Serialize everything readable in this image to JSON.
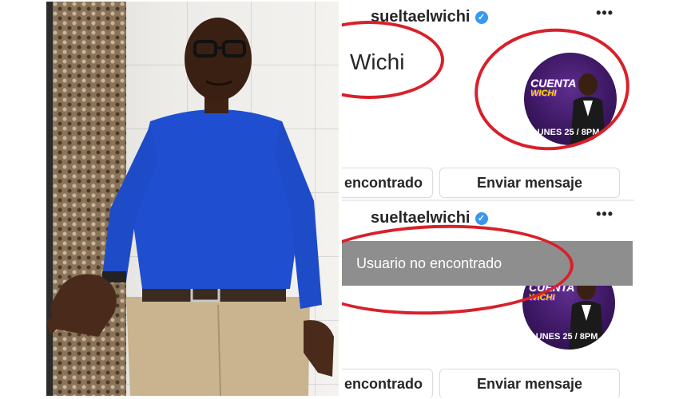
{
  "top_panel": {
    "username": "sueltaelwichi",
    "verified_icon": "verified-badge-icon",
    "more_icon": "more-options-icon",
    "display_name": "Wichi",
    "avatar": {
      "title_line1": "CUENTA",
      "title_line2": "WICHI",
      "date": "LUNES 25 / 8PM"
    },
    "buttons": {
      "left": "encontrado",
      "right": "Enviar mensaje"
    }
  },
  "bottom_panel": {
    "username": "sueltaelwichi",
    "verified_icon": "verified-badge-icon",
    "more_icon": "more-options-icon",
    "banner": "Usuario no encontrado",
    "avatar": {
      "title_line1": "CUENTA",
      "title_line2": "WICHI",
      "date": "LUNES 25 / 8PM"
    },
    "buttons": {
      "left": "encontrado",
      "right": "Enviar mensaje"
    }
  },
  "colors": {
    "annotation_red": "#d8202a",
    "verified_blue": "#3897f0",
    "sweater_blue": "#1f4fd0"
  }
}
